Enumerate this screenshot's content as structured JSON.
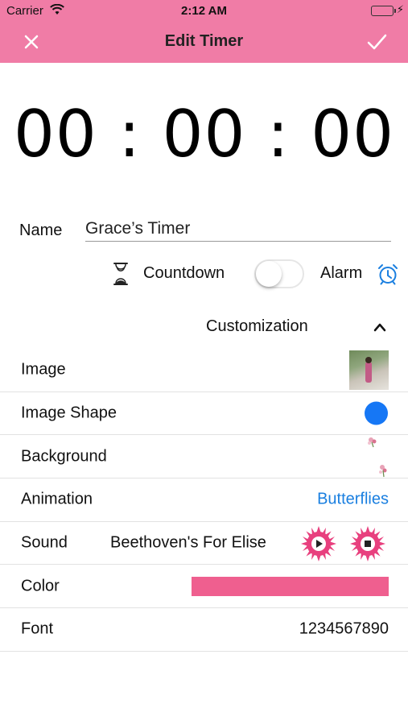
{
  "status_bar": {
    "carrier": "Carrier",
    "time": "2:12 AM"
  },
  "nav": {
    "title": "Edit Timer"
  },
  "timer": {
    "display": "00 : 00 : 00"
  },
  "name": {
    "label": "Name",
    "value": "Grace’s Timer"
  },
  "mode": {
    "countdown_label": "Countdown",
    "alarm_label": "Alarm",
    "toggle_on": false
  },
  "customization": {
    "label": "Customization",
    "expanded": true
  },
  "settings": {
    "image_label": "Image",
    "image_shape_label": "Image Shape",
    "background_label": "Background",
    "animation_label": "Animation",
    "animation_value": "Butterflies",
    "sound_label": "Sound",
    "sound_value": "Beethoven's For Elise",
    "color_label": "Color",
    "color_value": "#ef5f8f",
    "font_label": "Font",
    "font_value": "1234567890"
  },
  "colors": {
    "nav_bar": "#f07ca6",
    "accent_blue": "#1a7fe0",
    "shape_dot": "#1677f5",
    "sound_button": "#e8407e"
  },
  "icons": {
    "close": "close-icon",
    "done": "checkmark-icon",
    "hourglass": "hourglass-icon",
    "alarm": "alarm-clock-icon",
    "chevron": "chevron-up-icon",
    "play": "play-icon",
    "stop": "stop-icon"
  }
}
